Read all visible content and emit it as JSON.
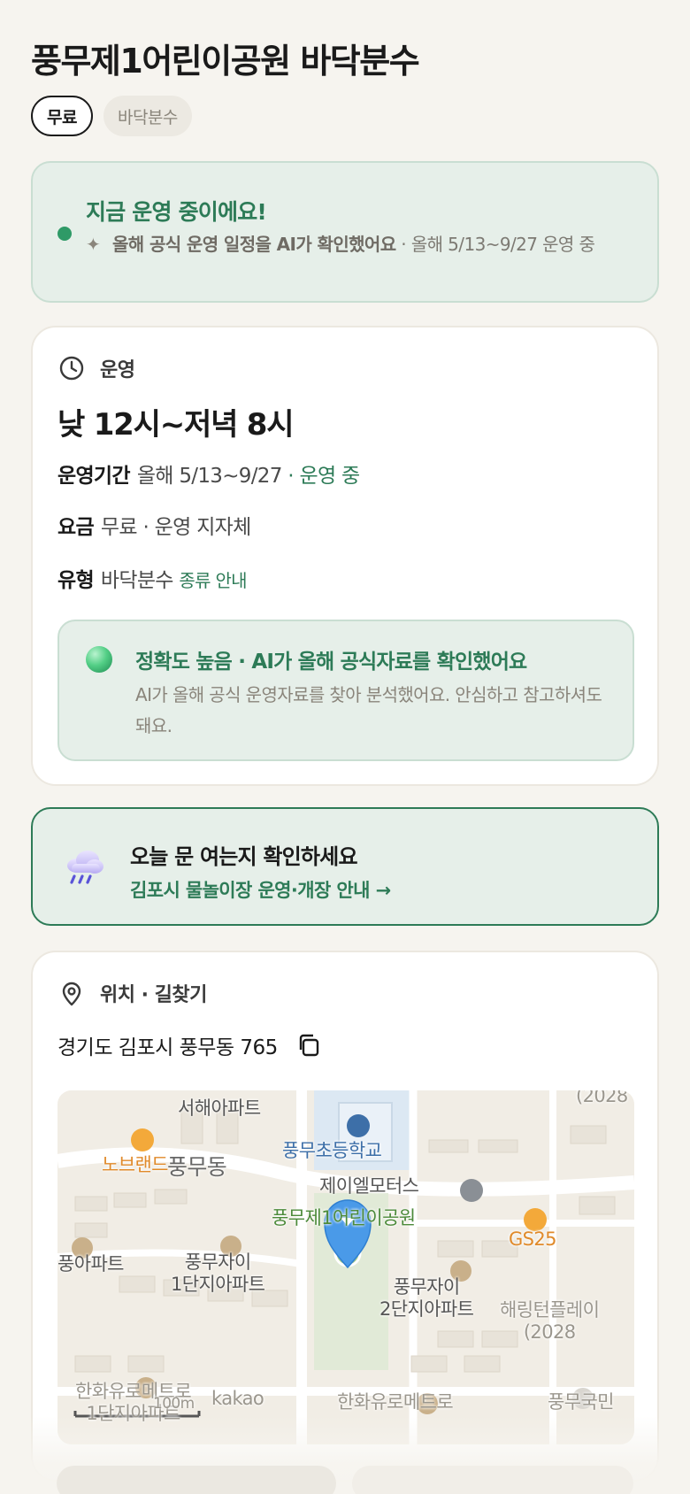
{
  "title": "풍무제1어린이공원 바닥분수",
  "chips": [
    "무료",
    "바닥분수"
  ],
  "status": {
    "title": "지금 운영 중이에요!",
    "sparkle": "✦",
    "sub_bold": "올해 공식 운영 일정을 AI가 확인했어요",
    "sub_rest": " · 올해 5/13~9/27 운영 중"
  },
  "operation": {
    "section": "운영",
    "hours": "낮 12시~저녁 8시",
    "period_key": "운영기간",
    "period_value": "올해 5/13~9/27",
    "period_status": " · 운영 중",
    "fee_key": "요금",
    "fee_value": "무료 · 운영 지자체",
    "type_key": "유형",
    "type_value": "바닥분수",
    "type_link": "종류 안내",
    "accuracy_title": "정확도 높음 · AI가 올해 공식자료를 확인했어요",
    "accuracy_text": "AI가 올해 공식 운영자료를 찾아 분석했어요. 안심하고 참고하셔도 돼요."
  },
  "check": {
    "title": "오늘 문 여는지 확인하세요",
    "link": "김포시 물놀이장 운영·개장 안내 →"
  },
  "location": {
    "section": "위치 · 길찾기",
    "address": "경기도 김포시 풍무동 765"
  },
  "map": {
    "labels": {
      "seohae": "서해아파트",
      "school": "풍무초등학교",
      "nobrand": "노브랜드",
      "dong": "풍무동",
      "motors": "제이엘모터스",
      "park": "풍무제1어린이공원",
      "gs25": "GS25",
      "apt_left": "풍아파트",
      "xi1": "풍무자이\n1단지아파트",
      "xi2": "풍무자이\n2단지아파트",
      "year_top": "(2028",
      "haering": "해링턴플레이\n(2028",
      "hanwha_left": "한화유로메트로\n1단지아파트",
      "hanwha_mid": "한화유로메트로",
      "pungmu_gukmin": "풍무국민",
      "scale": "100m",
      "kakao": "kakao"
    }
  }
}
